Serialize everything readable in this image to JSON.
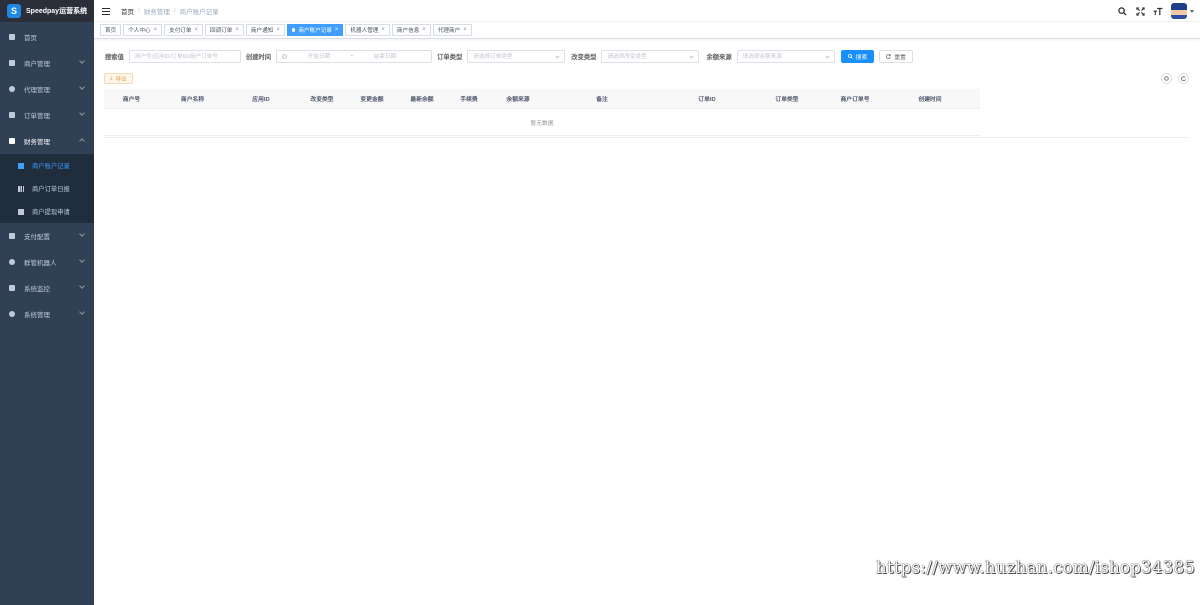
{
  "app": {
    "title": "Speedpay运营系统",
    "logo_letter": "S"
  },
  "sidebar": {
    "items": [
      {
        "label": "首页"
      },
      {
        "label": "商户管理"
      },
      {
        "label": "代理管理"
      },
      {
        "label": "订单管理"
      },
      {
        "label": "财务管理"
      }
    ],
    "sub_items": [
      {
        "label": "商户账户记录",
        "active": true
      },
      {
        "label": "商户订单日报"
      },
      {
        "label": "商户提现申请"
      }
    ],
    "items_after": [
      {
        "label": "支付配置"
      },
      {
        "label": "群管机器人"
      },
      {
        "label": "系统监控"
      },
      {
        "label": "系统管理"
      }
    ]
  },
  "breadcrumb": [
    "首页",
    "财务管理",
    "商户账户记录"
  ],
  "tags": [
    {
      "label": "首页",
      "closable": false
    },
    {
      "label": "个人中心",
      "closable": true
    },
    {
      "label": "支付订单",
      "closable": true
    },
    {
      "label": "回调订单",
      "closable": true
    },
    {
      "label": "商户通知",
      "closable": true
    },
    {
      "label": "商户账户记录",
      "closable": true,
      "active": true
    },
    {
      "label": "机器人管理",
      "closable": true
    },
    {
      "label": "商户信息",
      "closable": true
    },
    {
      "label": "代理商户",
      "closable": true
    }
  ],
  "tag_close_glyph": "×",
  "filter": {
    "search_label": "搜索值",
    "search_placeholder": "商户号/应用ID/订单ID/商户订单号",
    "time_label": "创建时间",
    "start_placeholder": "开始日期",
    "range_sep": "-",
    "end_placeholder": "结束日期",
    "order_type_label": "订单类型",
    "order_type_placeholder": "请选择订单类型",
    "change_type_label": "改变类型",
    "change_type_placeholder": "请选择改变类型",
    "source_label": "余额来源",
    "source_placeholder": "请选择余额来源",
    "search_button": "搜索",
    "reset_button": "重置"
  },
  "export_button": "导出",
  "table": {
    "columns": [
      "商户号",
      "商户名称",
      "应用ID",
      "改变类型",
      "变更金额",
      "最新余额",
      "手续费",
      "余额来源",
      "备注",
      "订单ID",
      "订单类型",
      "商户订单号",
      "创建时间"
    ],
    "empty_text": "暂无数据"
  },
  "watermark": "https://www.huzhan.com/ishop34385",
  "colors": {
    "sidebar_bg": "#304156",
    "primary": "#1890ff",
    "active_tag": "#409eff",
    "warning": "#e6a23c"
  }
}
